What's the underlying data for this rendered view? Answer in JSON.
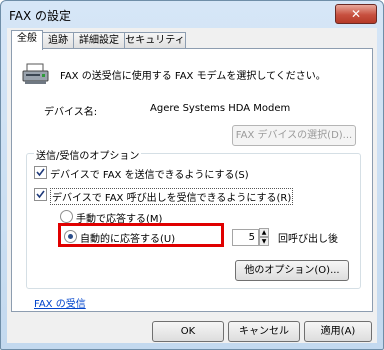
{
  "window": {
    "title": "FAX の設定",
    "close_glyph": "✕"
  },
  "tabs": [
    {
      "label": "全般"
    },
    {
      "label": "追跡"
    },
    {
      "label": "詳細設定"
    },
    {
      "label": "セキュリティ"
    }
  ],
  "general": {
    "description": "FAX の送受信に使用する FAX モデムを選択してください。",
    "device_label": "デバイス名:",
    "device_value": "Agere Systems HDA Modem",
    "select_device_button": "FAX デバイスの選択(D)..."
  },
  "options": {
    "title": "送信/受信のオプション",
    "send_checkbox": "デバイスで FAX を送信できるようにする(S)",
    "receive_checkbox": "デバイスで FAX 呼び出しを受信できるようにする(R)",
    "manual_radio": "手動で応答する(M)",
    "auto_radio": "自動的に応答する(U)",
    "rings_value": "5",
    "rings_suffix": "回呼び出し後",
    "more_options_button": "他のオプション(O)..."
  },
  "fax_receive_link": "FAX の受信",
  "footer": {
    "ok": "OK",
    "cancel": "キャンセル",
    "apply": "適用(A)"
  }
}
